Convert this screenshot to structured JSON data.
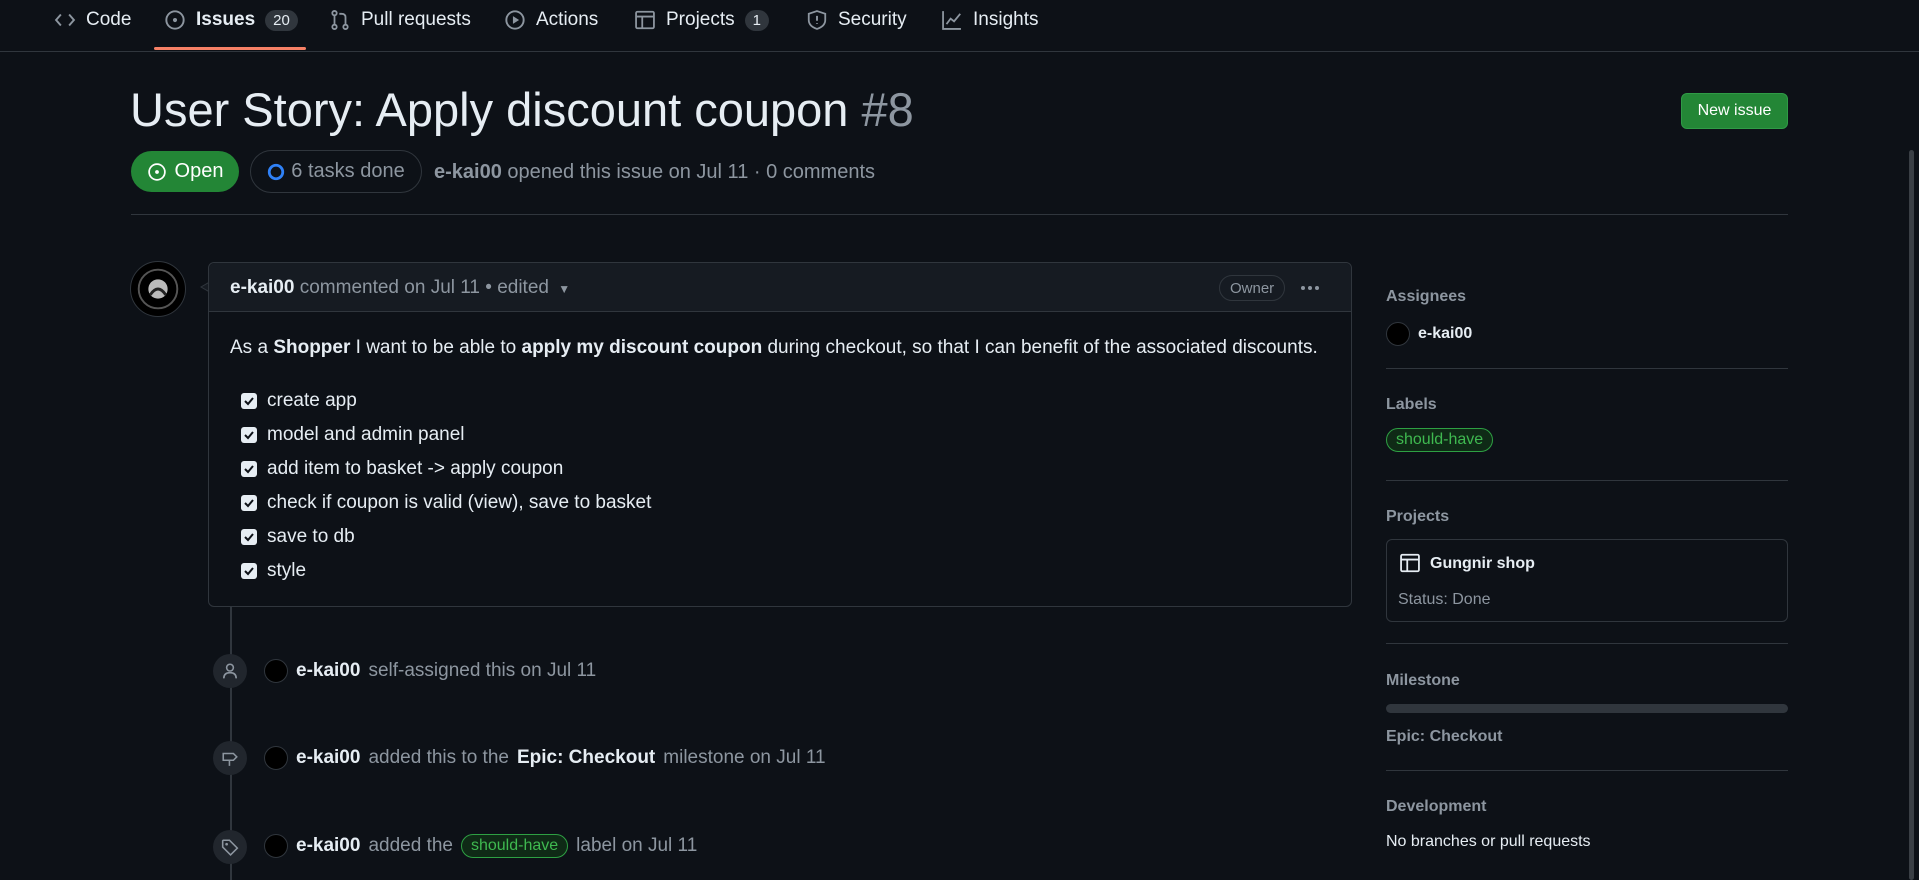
{
  "nav": {
    "items": [
      {
        "label": "Code",
        "icon": "code-icon"
      },
      {
        "label": "Issues",
        "icon": "issue-opened-icon",
        "count": "20"
      },
      {
        "label": "Pull requests",
        "icon": "git-pull-request-icon"
      },
      {
        "label": "Actions",
        "icon": "play-icon"
      },
      {
        "label": "Projects",
        "icon": "table-icon",
        "count": "1"
      },
      {
        "label": "Security",
        "icon": "shield-icon"
      },
      {
        "label": "Insights",
        "icon": "graph-icon"
      }
    ],
    "active": "Issues",
    "accent": "#f78166"
  },
  "issue": {
    "title": "User Story: Apply discount coupon",
    "number": "#8",
    "state": "Open",
    "tasks": "6 tasks done",
    "author": "e-kai00",
    "meta_rest": "opened this issue on Jul 11 · 0 comments",
    "new_issue_label": "New issue"
  },
  "comment": {
    "author": "e-kai00",
    "meta": "commented on Jul 11 • edited",
    "role": "Owner",
    "body": {
      "p1": "As a ",
      "b1": "Shopper",
      "p2": " I want to be able to ",
      "b2": "apply my discount coupon",
      "p3": " during checkout, so that I can benefit of the associated discounts."
    },
    "tasks": [
      {
        "text": "create app",
        "checked": true
      },
      {
        "text": "model and admin panel",
        "checked": true
      },
      {
        "text": "add item to basket -> apply coupon",
        "checked": true
      },
      {
        "text": "check if coupon is valid (view), save to basket",
        "checked": true
      },
      {
        "text": "save to db",
        "checked": true
      },
      {
        "text": "style",
        "checked": true
      }
    ]
  },
  "timeline": {
    "event1": {
      "user": "e-kai00",
      "text": "self-assigned this on Jul 11"
    },
    "event2": {
      "user": "e-kai00",
      "pre": "added this to the",
      "milestone": "Epic: Checkout",
      "post": "milestone on Jul 11"
    },
    "event3": {
      "user": "e-kai00",
      "pre": "added the",
      "label": "should-have",
      "post": "label on Jul 11"
    }
  },
  "sidebar": {
    "assignees_heading": "Assignees",
    "assignee": "e-kai00",
    "labels_heading": "Labels",
    "label": "should-have",
    "projects_heading": "Projects",
    "project_name": "Gungnir shop",
    "project_status": "Status: Done",
    "milestone_heading": "Milestone",
    "milestone_name": "Epic: Checkout",
    "development_heading": "Development",
    "development_text": "No branches or pull requests"
  },
  "colors": {
    "green": "#238636",
    "label_green": "#3fb950",
    "bg": "#0d1117",
    "progress_blue": "#2f81f7"
  }
}
